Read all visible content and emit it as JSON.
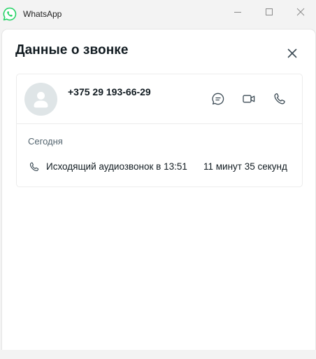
{
  "window": {
    "app_title": "WhatsApp",
    "icon": "whatsapp-logo-icon",
    "controls": [
      "minimize-icon",
      "maximize-icon",
      "close-icon"
    ]
  },
  "panel": {
    "title": "Данные о звонке",
    "close_icon": "close-icon"
  },
  "contact": {
    "phone": "+375 29 193-66-29",
    "avatar_icon": "default-avatar-icon",
    "actions": [
      "message-icon",
      "video-call-icon",
      "voice-call-icon"
    ]
  },
  "history": {
    "date_label": "Сегодня",
    "entries": [
      {
        "icon": "phone-icon",
        "description": "Исходящий аудиозвонок в 13:51",
        "duration": "11 минут 35 секунд"
      }
    ]
  },
  "colors": {
    "brand": "#25d366",
    "text_primary": "#111b21",
    "text_secondary": "#54656f",
    "background": "#f3f3f3"
  }
}
